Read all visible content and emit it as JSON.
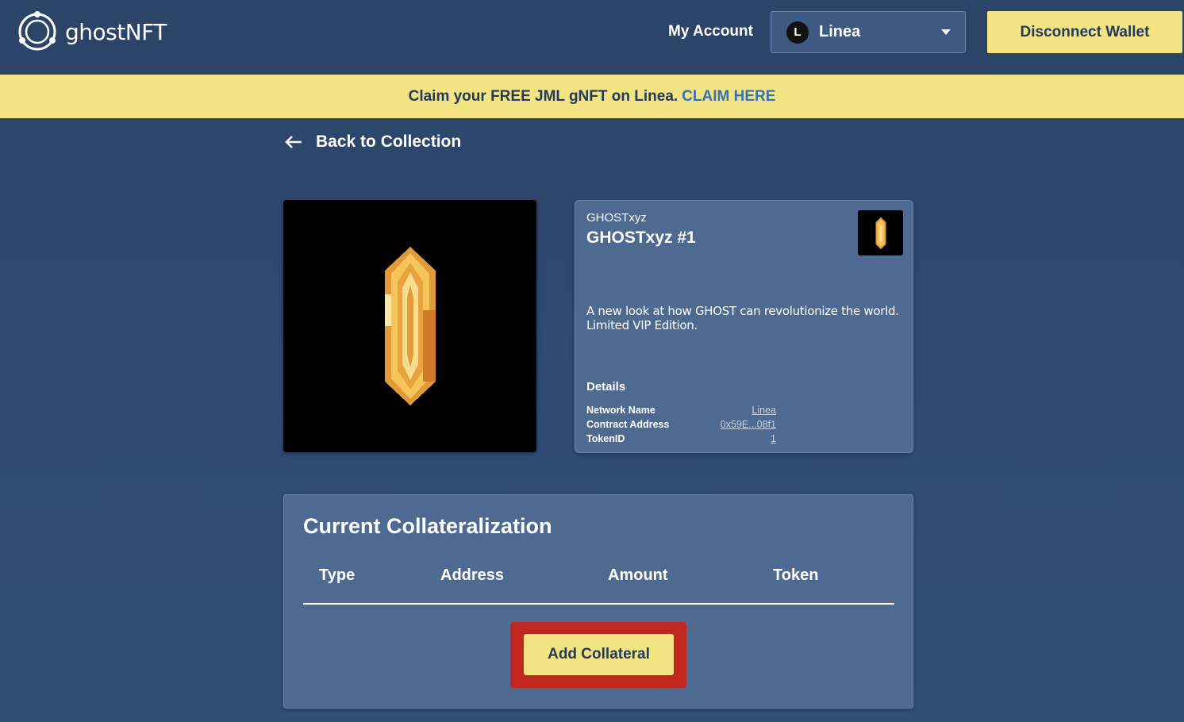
{
  "header": {
    "logo_text": "ghostNFT",
    "my_account": "My Account",
    "network": {
      "icon_letter": "L",
      "label": "Linea"
    },
    "disconnect": "Disconnect Wallet"
  },
  "banner": {
    "text": "Claim your FREE JML gNFT on Linea.",
    "link": "CLAIM HERE"
  },
  "back_link": "Back to Collection",
  "nft": {
    "collection": "GHOSTxyz",
    "title": "GHOSTxyz #1",
    "description": "A new look at how GHOST can revolutionize the world. Limited VIP Edition.",
    "details_heading": "Details",
    "details": [
      {
        "key": "Network Name",
        "value": "Linea"
      },
      {
        "key": "Contract Address",
        "value": "0x59E...08f1"
      },
      {
        "key": "TokenID",
        "value": "1"
      }
    ]
  },
  "collateralization": {
    "title": "Current Collateralization",
    "columns": [
      "Type",
      "Address",
      "Amount",
      "Token"
    ],
    "add_button": "Add Collateral"
  },
  "colors": {
    "accent_yellow": "#f2e383",
    "highlight_red": "#c0271e",
    "card_bg": "#4e6a91",
    "page_bg": "#2b4468"
  }
}
